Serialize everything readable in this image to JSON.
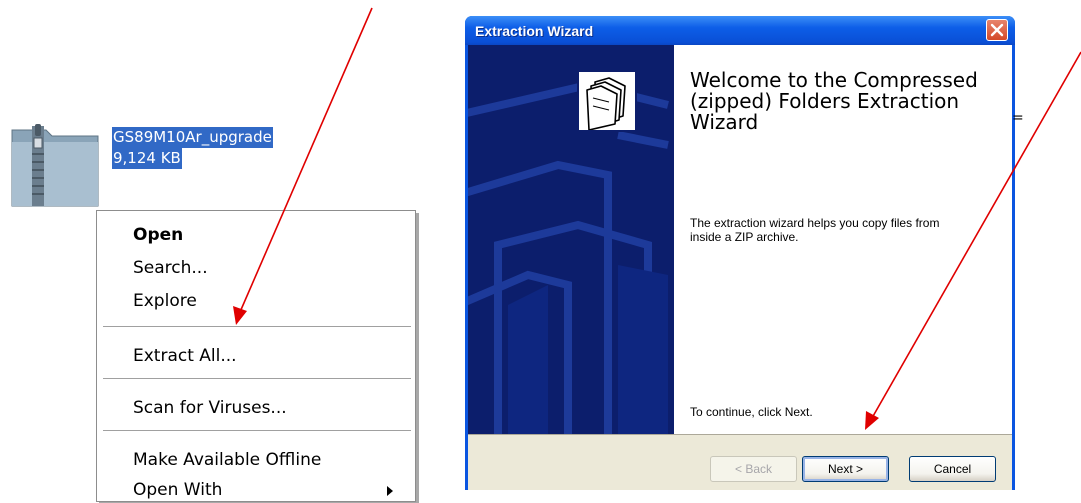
{
  "file": {
    "name": "GS89M10Ar_upgrade",
    "size": "9,124 KB",
    "icon": "zip-folder-icon"
  },
  "context_menu": {
    "items": [
      {
        "label": "Open",
        "bold": true
      },
      {
        "label": "Search..."
      },
      {
        "label": "Explore"
      },
      {
        "label": "Extract All..."
      },
      {
        "label": "Scan for Viruses..."
      },
      {
        "label": "Make Available Offline"
      },
      {
        "label": "Open With",
        "submenu": true
      }
    ]
  },
  "wizard": {
    "title": "Extraction Wizard",
    "close_icon": "close-icon",
    "welcome_title": "Welcome to the Compressed (zipped) Folders Extraction Wizard",
    "description": "The extraction wizard helps you copy files from inside a ZIP archive.",
    "continue_text": "To continue, click Next.",
    "buttons": {
      "back": "< Back",
      "next": "Next >",
      "cancel": "Cancel"
    },
    "colors": {
      "title_bar": "#0a55e0",
      "banner": "#0c1e6c",
      "close_button": "#d44a29"
    }
  },
  "background_text": {
    "clipped_char": "="
  },
  "annotations": {
    "arrow_color": "#e00000"
  }
}
